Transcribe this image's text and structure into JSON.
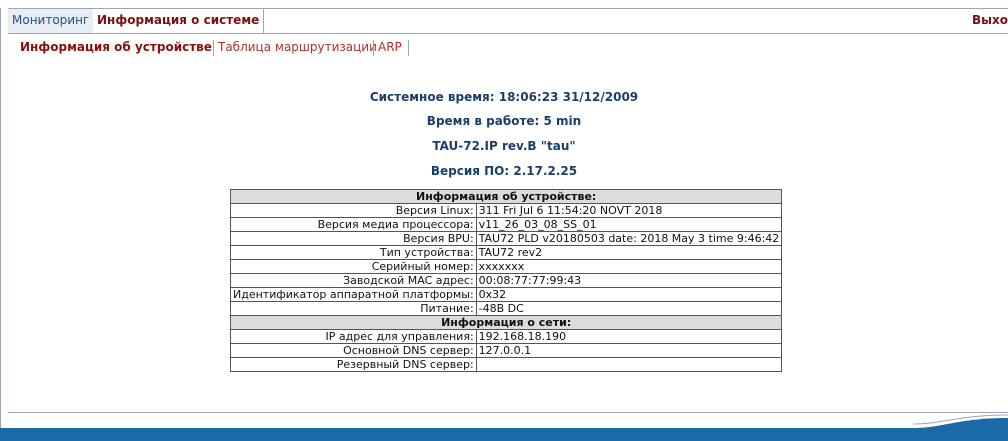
{
  "nav": {
    "tabs": [
      {
        "label": "Мониторинг"
      },
      {
        "label": "Информация о системе"
      }
    ],
    "exit_label": "Выхо"
  },
  "subtabs": [
    {
      "label": "Информация об устройстве"
    },
    {
      "label": "Таблица маршрутизации"
    },
    {
      "label": "ARP"
    }
  ],
  "summary": {
    "system_time": "Системное время: 18:06:23  31/12/2009",
    "uptime": "Время в работе: 5 min",
    "model": "TAU-72.IP rev.B \"tau\"",
    "firmware": "Версия ПО: 2.17.2.25"
  },
  "device_info": {
    "header": "Информация об устройстве:",
    "rows": [
      {
        "label": "Версия Linux:",
        "value": "311 Fri Jul 6 11:54:20 NOVT 2018"
      },
      {
        "label": "Версия медиа процессора:",
        "value": "v11_26_03_08_SS_01"
      },
      {
        "label": "Версия BPU:",
        "value": "TAU72   PLD v20180503 date: 2018 May 3 time 9:46:42"
      },
      {
        "label": "Тип устройства:",
        "value": "TAU72  rev2"
      },
      {
        "label": "Серийный номер:",
        "value": "xxxxxxx"
      },
      {
        "label": "Заводской MAC адрес:",
        "value": "00:08:77:77:99:43"
      },
      {
        "label": "Идентификатор аппаратной платформы:",
        "value": "0x32"
      },
      {
        "label": "Питание:",
        "value": "-48B DC"
      }
    ]
  },
  "network_info": {
    "header": "Информация о сети:",
    "rows": [
      {
        "label": "IP адрес для управления:",
        "value": "192.168.18.190"
      },
      {
        "label": "Основной DNS сервер:",
        "value": "127.0.0.1"
      },
      {
        "label": "Резервный DNS сервер:",
        "value": ""
      }
    ]
  }
}
